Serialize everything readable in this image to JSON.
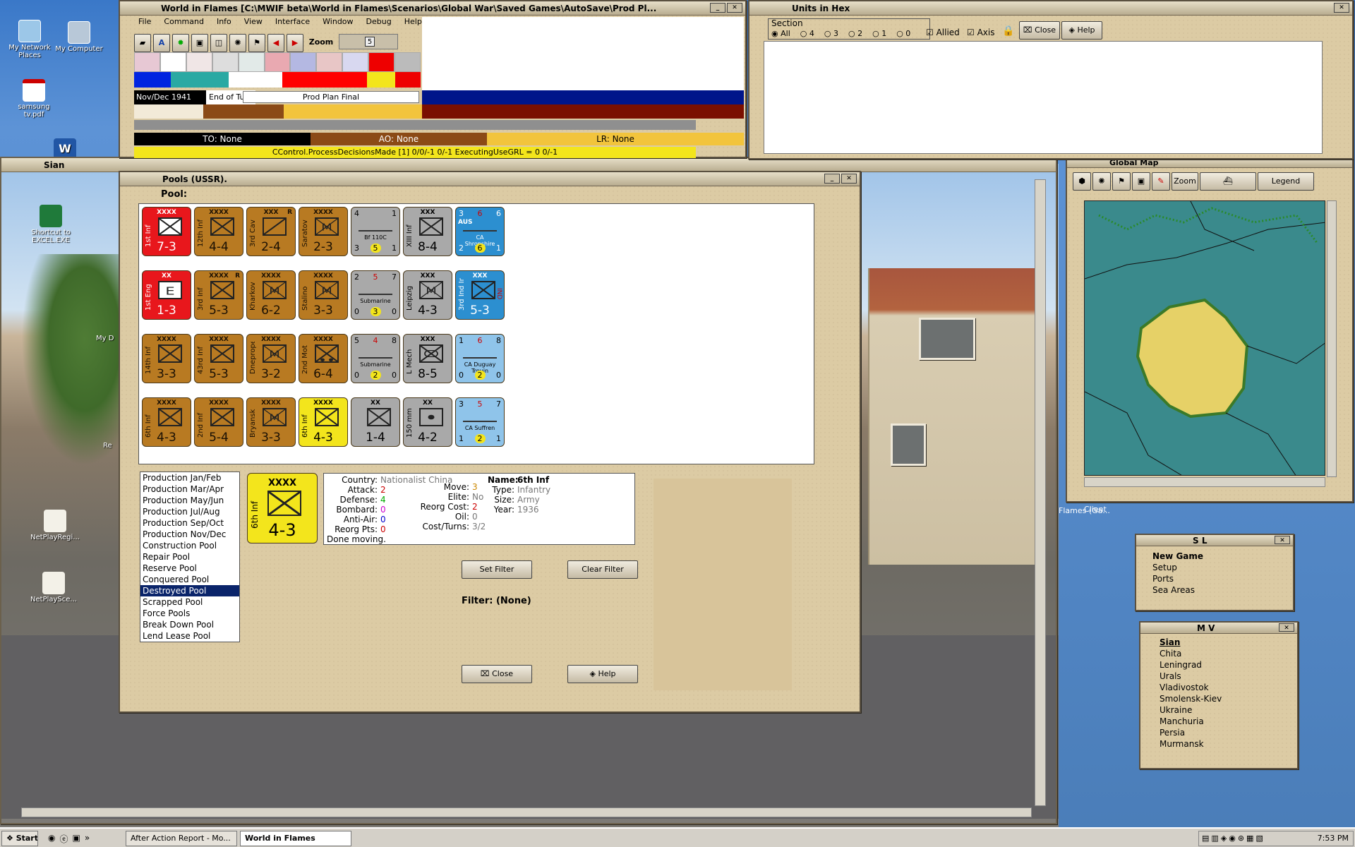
{
  "desktop": {
    "icons": [
      "My Network Places",
      "My Computer",
      "samsung tv.pdf",
      "Shortcut to EXCEL.EXE",
      "NetPlayRegi...",
      "NetPlaySce...",
      "My D",
      "Re"
    ]
  },
  "main_window": {
    "title": "World in Flames [C:\\MWIF beta\\World in Flames\\Scenarios\\Global War\\Saved Games\\AutoSave\\Prod Pl...",
    "menu": [
      "File",
      "Command",
      "Info",
      "View",
      "Interface",
      "Window",
      "Debug",
      "Help"
    ],
    "zoom_label": "Zoom",
    "zoom_value": "5",
    "date": "Nov/Dec 1941",
    "phase_label": "End of Turn",
    "phase_value": "Prod Plan Final",
    "to_label": "TO: None",
    "ao_label": "AO: None",
    "lr_label": "LR: None",
    "status_line": "CControl.ProcessDecisionsMade [1] 0/0/-1 0/-1 ExecutingUseGRL = 0 0/-1"
  },
  "units_window": {
    "title": "Units in Hex",
    "section_label": "Section",
    "radios": [
      "All",
      "4",
      "3",
      "2",
      "1",
      "0"
    ],
    "allied_label": "Allied",
    "axis_label": "Axis",
    "close_label": "Close",
    "help_label": "Help"
  },
  "map_window": {
    "title": "Sian",
    "client_label": "Client",
    "flames_label": "Flames (Ga..."
  },
  "global_map": {
    "title": "Global Map",
    "zoom_label": "Zoom",
    "legend_label": "Legend"
  },
  "pools_window": {
    "title": "Pools (USSR).",
    "pool_label": "Pool:",
    "counters": [
      {
        "style": "red",
        "size": "XXXX",
        "name": "1st Inf",
        "value": "7-3",
        "symbol": "inf"
      },
      {
        "style": "brown",
        "size": "XXXX",
        "name": "12th Inf",
        "value": "4-4",
        "symbol": "inf"
      },
      {
        "style": "brown",
        "size": "XXX",
        "name": "3rd Cav",
        "value": "2-4",
        "symbol": "cav",
        "corner": "R"
      },
      {
        "style": "brown",
        "size": "XXXX",
        "name": "Saratov",
        "value": "2-3",
        "symbol": "mil"
      },
      {
        "style": "gray",
        "name": "Bf 110C",
        "value": "3 5 1",
        "symbol": "air",
        "top_left": "4",
        "top_right": "1"
      },
      {
        "style": "gray",
        "size": "XXX",
        "name": "XIII Inf",
        "value": "8-4",
        "symbol": "inf"
      },
      {
        "style": "blue",
        "name": "CA Shropshire",
        "value": "2 6 1",
        "symbol": "ship",
        "top_left": "3",
        "top_mid": "6",
        "top_right": "6",
        "flag": "AUS"
      },
      {
        "style": "red",
        "size": "XX",
        "name": "1st Eng",
        "value": "1-3",
        "symbol": "eng"
      },
      {
        "style": "brown",
        "size": "XXXX",
        "name": "3rd Inf",
        "value": "5-3",
        "symbol": "inf",
        "corner": "R"
      },
      {
        "style": "brown",
        "size": "XXXX",
        "name": "Kharkov",
        "value": "6-2",
        "symbol": "mil"
      },
      {
        "style": "brown",
        "size": "XXXX",
        "name": "Stalino",
        "value": "3-3",
        "symbol": "mil"
      },
      {
        "style": "gray",
        "name": "Submarine",
        "value": "0 3 0",
        "symbol": "sub",
        "top_left": "2",
        "top_mid": "5",
        "top_right": "7"
      },
      {
        "style": "gray",
        "size": "XXX",
        "name": "Leipzig",
        "value": "4-3",
        "symbol": "mil"
      },
      {
        "style": "blue",
        "size": "XXX",
        "name": "3rd Ind Inf",
        "value": "5-3",
        "symbol": "inf",
        "flag": "IND"
      },
      {
        "style": "brown",
        "size": "XXXX",
        "name": "14th Inf",
        "value": "3-3",
        "symbol": "inf"
      },
      {
        "style": "brown",
        "size": "XXXX",
        "name": "43rd Inf",
        "value": "5-3",
        "symbol": "inf"
      },
      {
        "style": "brown",
        "size": "XXXX",
        "name": "Dnepropet",
        "value": "3-2",
        "symbol": "mil"
      },
      {
        "style": "brown",
        "size": "XXXX",
        "name": "2nd Mot",
        "value": "6-4",
        "symbol": "mot"
      },
      {
        "style": "gray",
        "name": "Submarine",
        "value": "0 2 0",
        "symbol": "sub",
        "top_left": "5",
        "top_mid": "4",
        "top_right": "8"
      },
      {
        "style": "gray",
        "size": "XXX",
        "name": "L Mech",
        "value": "8-5",
        "symbol": "mech"
      },
      {
        "style": "lblue",
        "name": "CA Duguay Trouin",
        "value": "0 2 0",
        "symbol": "ship",
        "top_left": "1",
        "top_mid": "6",
        "top_right": "8"
      },
      {
        "style": "brown",
        "size": "XXXX",
        "name": "6th Inf",
        "value": "4-3",
        "symbol": "inf"
      },
      {
        "style": "brown",
        "size": "XXXX",
        "name": "2nd Inf",
        "value": "5-4",
        "symbol": "inf"
      },
      {
        "style": "brown",
        "size": "XXXX",
        "name": "Bryansk",
        "value": "3-3",
        "symbol": "mil"
      },
      {
        "style": "yel",
        "size": "XXXX",
        "name": "6th Inf",
        "value": "4-3",
        "symbol": "inf"
      },
      {
        "style": "gray",
        "size": "XX",
        "name": "",
        "value": "1-4",
        "symbol": "inf"
      },
      {
        "style": "gray",
        "size": "XX",
        "name": "150 mm",
        "value": "4-2",
        "symbol": "art"
      },
      {
        "style": "lblue",
        "name": "CA Suffren",
        "value": "1 2 1",
        "symbol": "ship",
        "top_left": "3",
        "top_mid": "5",
        "top_right": "7"
      }
    ],
    "pool_list": [
      "Production Jan/Feb",
      "Production Mar/Apr",
      "Production May/Jun",
      "Production Jul/Aug",
      "Production Sep/Oct",
      "Production Nov/Dec",
      "Construction Pool",
      "Repair Pool",
      "Reserve Pool",
      "Conquered Pool",
      "Destroyed Pool",
      "Scrapped Pool",
      "Force Pools",
      "Break Down Pool",
      "Lend Lease Pool"
    ],
    "selected_pool": "Destroyed Pool",
    "selected_counter": {
      "size": "XXXX",
      "name": "6th Inf",
      "value": "4-3"
    },
    "details": {
      "country_label": "Country:",
      "country": "Nationalist China",
      "attack_label": "Attack:",
      "attack": "2",
      "defense_label": "Defense:",
      "defense": "4",
      "bombard_label": "Bombard:",
      "bombard": "0",
      "antiair_label": "Anti-Air:",
      "antiair": "0",
      "reorg_pts_label": "Reorg Pts:",
      "reorg_pts": "0",
      "done": "Done moving.",
      "move_label": "Move:",
      "move": "3",
      "elite_label": "Elite:",
      "elite": "No",
      "reorg_cost_label": "Reorg Cost:",
      "reorg_cost": "2",
      "oil_label": "Oil:",
      "oil": "0",
      "cost_label": "Cost/Turns:",
      "cost": "3/2",
      "name_label": "Name:",
      "name": "6th Inf",
      "type_label": "Type:",
      "type": "Infantry",
      "size_label": "Size:",
      "size": "Army",
      "year_label": "Year:",
      "year": "1936"
    },
    "set_filter_label": "Set Filter",
    "clear_filter_label": "Clear Filter",
    "filter_text": "Filter: (None)",
    "close_label": "Close",
    "help_label": "Help"
  },
  "sl_window": {
    "title": "S L",
    "items": [
      "New Game",
      "Setup",
      "Ports",
      "Sea Areas"
    ]
  },
  "mv_window": {
    "title": "M V",
    "items": [
      "Sian",
      "Chita",
      "Leningrad",
      "Urals",
      "Vladivostok",
      "Smolensk-Kiev",
      "Ukraine",
      "Manchuria",
      "Persia",
      "Murmansk"
    ]
  },
  "taskbar": {
    "start_label": "Start",
    "tasks": [
      "After Action Report - Mo...",
      "World in Flames"
    ],
    "clock": "7:53 PM"
  }
}
